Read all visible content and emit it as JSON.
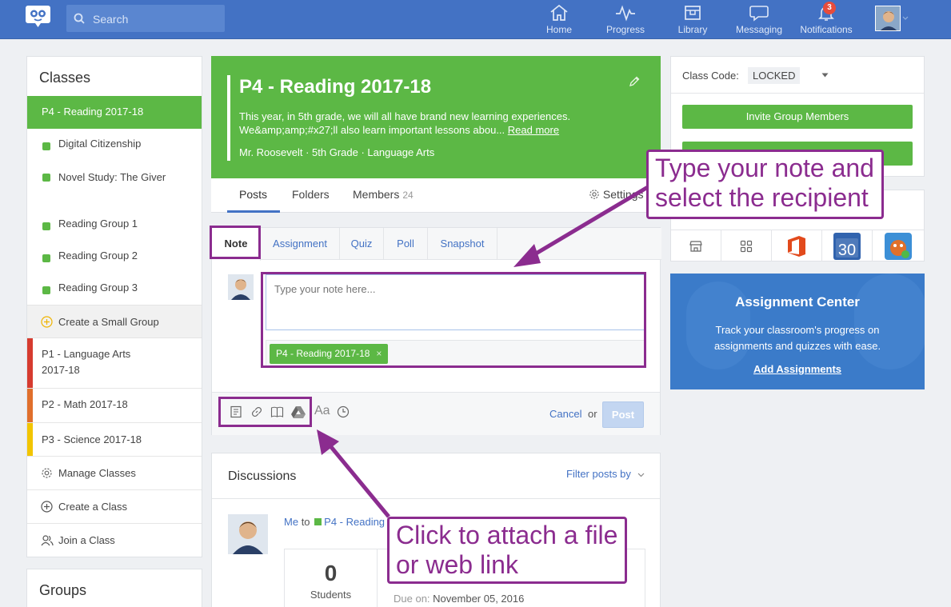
{
  "topnav": {
    "search_placeholder": "Search",
    "items": [
      {
        "label": "Home",
        "icon": "home-icon"
      },
      {
        "label": "Progress",
        "icon": "progress-icon"
      },
      {
        "label": "Library",
        "icon": "library-icon"
      },
      {
        "label": "Messaging",
        "icon": "messaging-icon"
      },
      {
        "label": "Notifications",
        "icon": "bell-icon",
        "badge": "3"
      }
    ]
  },
  "sidebar": {
    "title": "Classes",
    "active_class": "P4 - Reading 2017-18",
    "groups": [
      "Digital Citizenship",
      "Novel Study: The Giver",
      "Reading Group 1",
      "Reading Group 2",
      "Reading Group 3"
    ],
    "create_small_group": "Create a Small Group",
    "classes": [
      {
        "label": "P1 - Language Arts 2017-18",
        "color": "#d63b2f"
      },
      {
        "label": "P2 - Math 2017-18",
        "color": "#e06f2c"
      },
      {
        "label": "P3 - Science 2017-18",
        "color": "#f2c500"
      }
    ],
    "manage": "Manage Classes",
    "create_class": "Create a Class",
    "join_class": "Join a Class",
    "groups_title": "Groups"
  },
  "banner": {
    "title": "P4 - Reading 2017-18",
    "description": "This year, in 5th grade, we will all have brand new learning experiences. We&amp;amp;#x27;ll also learn important lessons abou...",
    "read_more": "Read more",
    "meta": "Mr. Roosevelt · 5th Grade · Language Arts"
  },
  "tabs": {
    "posts": "Posts",
    "folders": "Folders",
    "members": "Members",
    "members_count": "24",
    "settings": "Settings"
  },
  "composer": {
    "tabs": [
      "Note",
      "Assignment",
      "Quiz",
      "Poll",
      "Snapshot"
    ],
    "placeholder": "Type your note here...",
    "recipient": "P4 - Reading 2017-18",
    "text_format": "Aa",
    "cancel": "Cancel",
    "or": "or",
    "post": "Post"
  },
  "discussions": {
    "title": "Discussions",
    "filter": "Filter posts by",
    "author": "Me",
    "to": "to",
    "target": "P4 - Reading",
    "count": "0",
    "count_label": "Students",
    "due_label": "Due on:",
    "due_value": "November 05, 2016"
  },
  "right": {
    "class_code_label": "Class Code:",
    "class_code_value": "LOCKED",
    "invite_button": "Invite Group Members",
    "calendar_day": "30",
    "assignment_center": {
      "title": "Assignment Center",
      "description": "Track your classroom's progress on assignments and quizzes with ease.",
      "link": "Add Assignments"
    }
  },
  "callouts": {
    "note": "Type your note and select the recipient",
    "attach": "Click to attach a file or web link"
  },
  "colors": {
    "brand_blue": "#4372c4",
    "class_green": "#5cb845",
    "annotation_purple": "#8b2c8f"
  }
}
